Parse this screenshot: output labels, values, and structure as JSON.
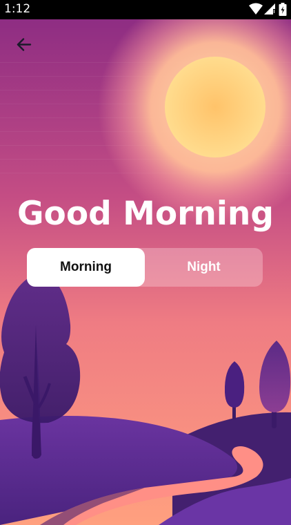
{
  "status_bar": {
    "time": "1:12",
    "icons": [
      "wifi-icon",
      "signal-icon",
      "battery-icon"
    ]
  },
  "header": {
    "back_icon": "arrow-left-icon"
  },
  "main": {
    "greeting": "Good Morning",
    "toggle": {
      "options": [
        "Morning",
        "Night"
      ],
      "selected": "Morning"
    }
  },
  "colors": {
    "sky_top": "#8e2d83",
    "sky_bottom": "#ff9c7c",
    "sun": "#ffd27a",
    "hills": "#5a2a8c",
    "path": "#ff8d86"
  }
}
